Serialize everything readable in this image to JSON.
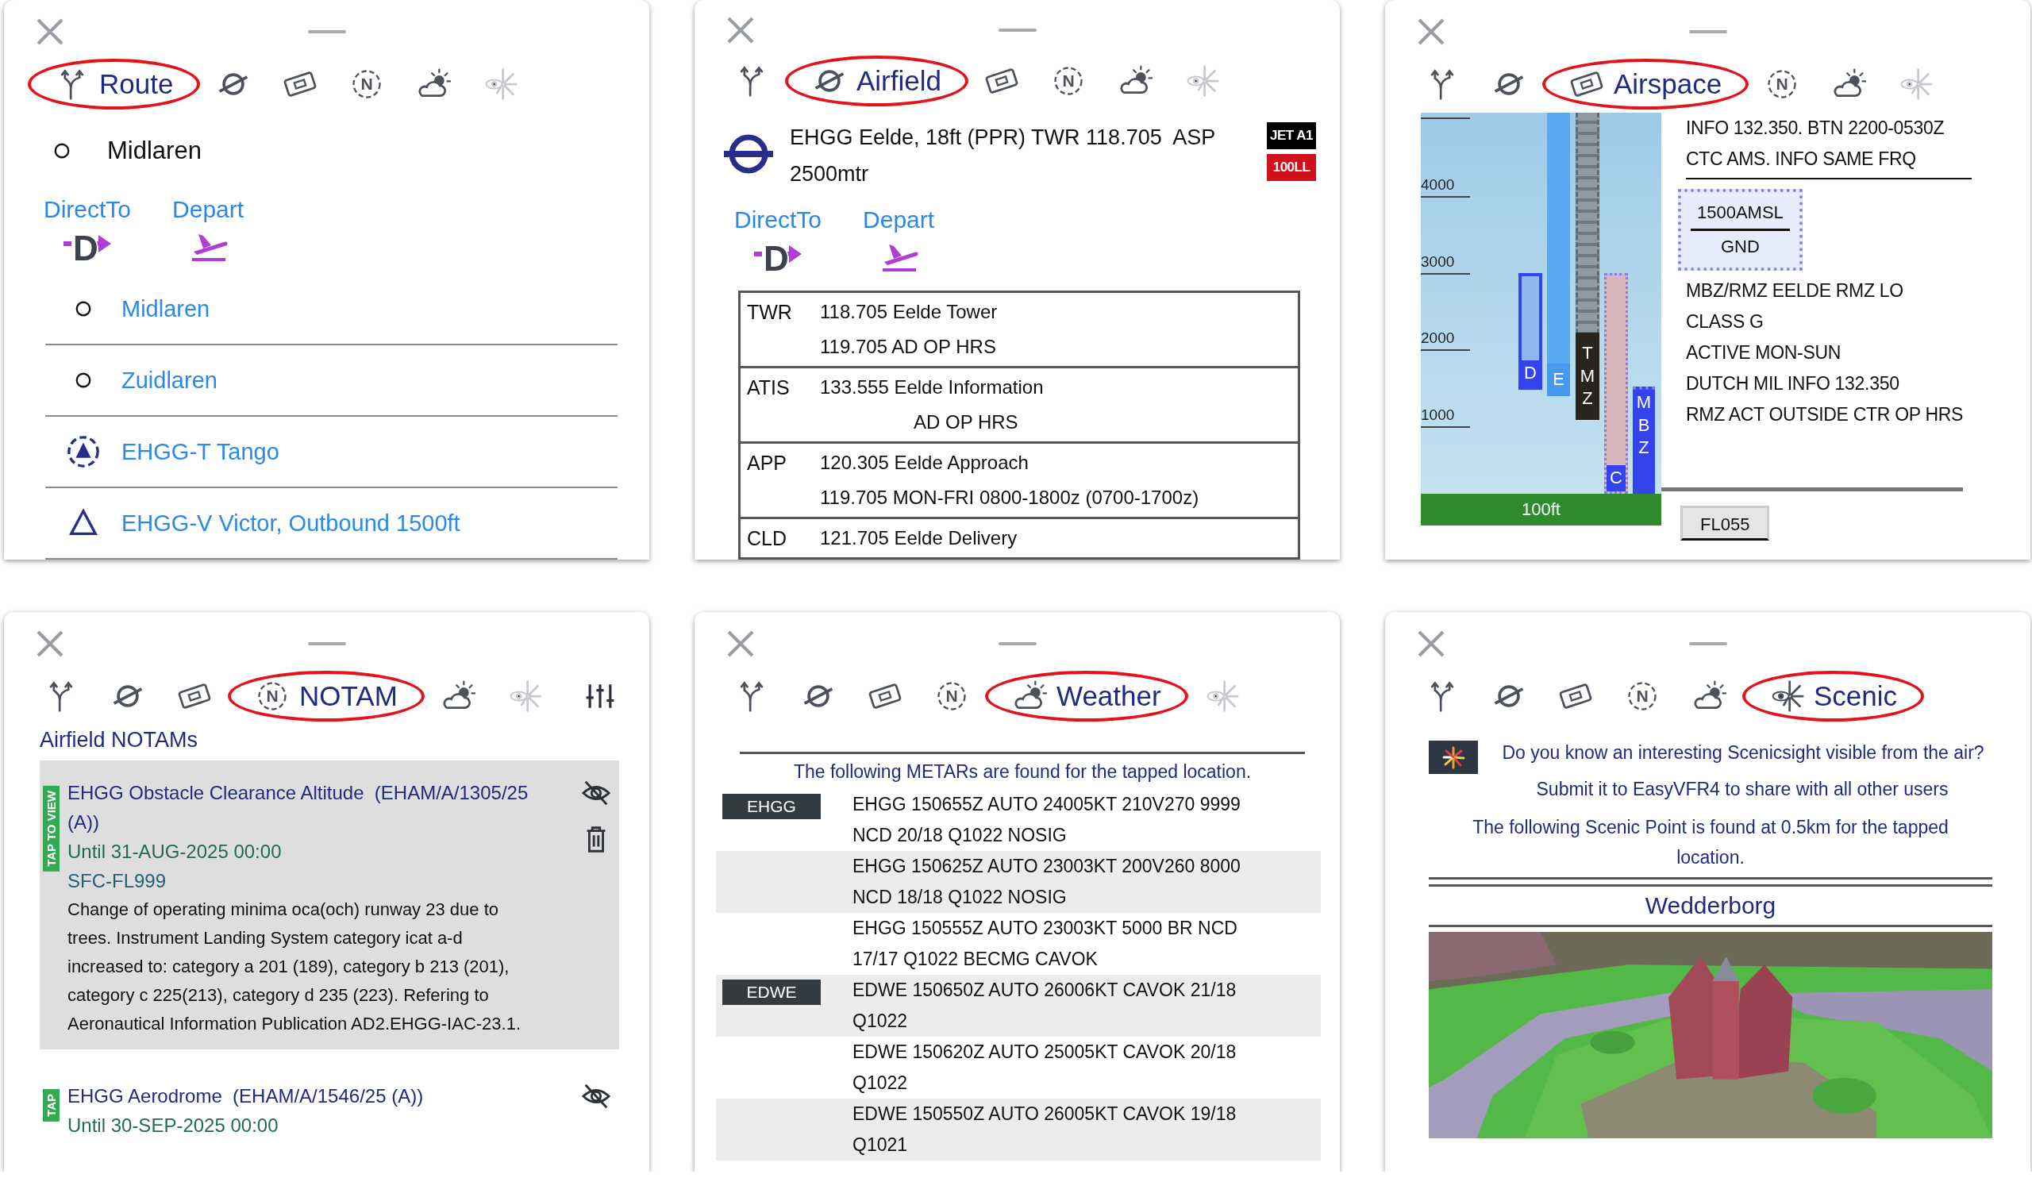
{
  "panels": [
    {
      "kind": "route",
      "tabs": [
        {
          "kind": "route",
          "label": "Route",
          "selected": true
        },
        {
          "kind": "airfield",
          "selected": false
        },
        {
          "kind": "airspace",
          "selected": false
        },
        {
          "kind": "notam",
          "glyph": "N",
          "selected": false
        },
        {
          "kind": "weather",
          "selected": false
        },
        {
          "kind": "scenic",
          "selected": false
        }
      ],
      "title": "Midlaren",
      "actions": [
        {
          "kind": "directto",
          "label": "DirectTo",
          "glyph": "D"
        },
        {
          "kind": "depart",
          "label": "Depart"
        }
      ],
      "points": [
        {
          "kind": "waypoint",
          "name": "Midlaren"
        },
        {
          "kind": "waypoint",
          "name": "Zuidlaren"
        },
        {
          "kind": "reporting",
          "name": "EHGG-T Tango"
        },
        {
          "kind": "triangle",
          "name": "EHGG-V Victor, Outbound 1500ft"
        }
      ]
    },
    {
      "kind": "airfield",
      "tabs": [
        {
          "kind": "route",
          "selected": false
        },
        {
          "kind": "airfield",
          "label": "Airfield",
          "selected": true
        },
        {
          "kind": "airspace",
          "selected": false
        },
        {
          "kind": "notam",
          "glyph": "N",
          "selected": false
        },
        {
          "kind": "weather",
          "selected": false
        },
        {
          "kind": "scenic",
          "selected": false
        }
      ],
      "title": "EHGG Eelde, 18ft (PPR) TWR 118.705  ASP 2500mtr",
      "fuels": [
        {
          "label": "JET A1",
          "color": "#000000"
        },
        {
          "label": "100LL",
          "color": "#d0101a"
        }
      ],
      "actions": [
        {
          "kind": "directto",
          "label": "DirectTo",
          "glyph": "D"
        },
        {
          "kind": "depart",
          "label": "Depart"
        }
      ],
      "frequencies": [
        {
          "service": "TWR",
          "lines": [
            {
              "text": "118.705 Eelde Tower",
              "indented": false
            },
            {
              "text": "119.705 AD OP HRS",
              "indented": false
            }
          ]
        },
        {
          "service": "ATIS",
          "lines": [
            {
              "text": "133.555 Eelde Information",
              "indented": false
            },
            {
              "text": "AD OP HRS",
              "indented": true
            }
          ]
        },
        {
          "service": "APP",
          "lines": [
            {
              "text": "120.305 Eelde Approach",
              "indented": false
            },
            {
              "text": "119.705 MON-FRI 0800-1800z (0700-1700z)",
              "indented": false
            }
          ]
        },
        {
          "service": "CLD",
          "lines": [
            {
              "text": "121.705 Eelde Delivery",
              "indented": false
            }
          ]
        }
      ]
    },
    {
      "kind": "airspace",
      "tabs": [
        {
          "kind": "route",
          "selected": false
        },
        {
          "kind": "airfield",
          "selected": false
        },
        {
          "kind": "airspace",
          "label": "Airspace",
          "selected": true
        },
        {
          "kind": "notam",
          "glyph": "N",
          "selected": false
        },
        {
          "kind": "weather",
          "selected": false
        },
        {
          "kind": "scenic",
          "selected": false
        }
      ],
      "profile": {
        "ticks": [
          "4000",
          "3000",
          "2000",
          "1000"
        ],
        "ground": "100ft",
        "zones": [
          {
            "kind": "class-d",
            "label": "D"
          },
          {
            "kind": "class-e",
            "label": "E"
          },
          {
            "kind": "tmz",
            "label": "TMZ"
          },
          {
            "kind": "class-c",
            "label": "C"
          },
          {
            "kind": "mbz",
            "label": "MBZ"
          }
        ]
      },
      "info": [
        "INFO 132.350. BTN 2200-0530Z",
        "CTC AMS. INFO SAME FRQ"
      ],
      "limits": {
        "upper": "1500AMSL",
        "lower": "GND"
      },
      "details": [
        "MBZ/RMZ EELDE RMZ LO",
        "CLASS G",
        "ACTIVE MON-SUN",
        "DUTCH MIL INFO 132.350",
        "RMZ ACT OUTSIDE CTR OP HRS"
      ],
      "next_limit": "FL055"
    },
    {
      "kind": "notam",
      "tabs": [
        {
          "kind": "route",
          "selected": false
        },
        {
          "kind": "airfield",
          "selected": false
        },
        {
          "kind": "airspace",
          "selected": false
        },
        {
          "kind": "notam",
          "glyph": "N",
          "label": "NOTAM",
          "selected": true
        },
        {
          "kind": "weather",
          "selected": false
        },
        {
          "kind": "scenic",
          "selected": false
        }
      ],
      "filter_button": true,
      "heading": "Airfield NOTAMs",
      "notams": [
        {
          "tag": "TAP TO VIEW",
          "title": "EHGG Obstacle Clearance Altitude  (EHAM/A/1305/25 (A))",
          "until": "Until 31-AUG-2025 00:00",
          "limits": "SFC-FL999",
          "body": "Change of operating minima oca(och) runway 23 due to trees. Instrument Landing System category icat a-d increased to: category a 201 (189), category b 213 (201), category c 225(213), category d 235 (223). Refering to Aeronautical Information Publication AD2.EHGG-IAC-23.1.",
          "expanded": true
        },
        {
          "tag": "TAP",
          "title": "EHGG Aerodrome  (EHAM/A/1546/25 (A))",
          "until": "Until 30-SEP-2025 00:00",
          "expanded": false
        }
      ]
    },
    {
      "kind": "weather",
      "tabs": [
        {
          "kind": "route",
          "selected": false
        },
        {
          "kind": "airfield",
          "selected": false
        },
        {
          "kind": "airspace",
          "selected": false
        },
        {
          "kind": "notam",
          "glyph": "N",
          "selected": false
        },
        {
          "kind": "weather",
          "label": "Weather",
          "selected": true
        },
        {
          "kind": "scenic",
          "selected": false
        }
      ],
      "intro": "The following METARs are found for the tapped location.",
      "stations": [
        {
          "code": "EHGG",
          "metars": [
            "EHGG 150655Z AUTO 24005KT 210V270 9999 NCD 20/18 Q1022 NOSIG",
            "EHGG 150625Z AUTO 23003KT 200V260 8000 NCD 18/18 Q1022 NOSIG",
            "EHGG 150555Z AUTO 23003KT 5000 BR NCD 17/17 Q1022 BECMG CAVOK"
          ]
        },
        {
          "code": "EDWE",
          "metars": [
            "EDWE 150650Z AUTO 26006KT CAVOK 21/18 Q1022",
            "EDWE 150620Z AUTO 25005KT CAVOK 20/18 Q1022",
            "EDWE 150550Z AUTO 26005KT CAVOK 19/18 Q1021"
          ]
        }
      ]
    },
    {
      "kind": "scenic",
      "tabs": [
        {
          "kind": "route",
          "selected": false
        },
        {
          "kind": "airfield",
          "selected": false
        },
        {
          "kind": "airspace",
          "selected": false
        },
        {
          "kind": "notam",
          "glyph": "N",
          "selected": false
        },
        {
          "kind": "weather",
          "selected": false
        },
        {
          "kind": "scenic",
          "label": "Scenic",
          "selected": true
        }
      ],
      "prompt": "Do you know an interesting Scenicsight visible from the air?",
      "submit": "Submit it to EasyVFR4 to share with all other users",
      "found": "The following Scenic Point is found at 0.5km for the tapped location.",
      "name": "Wedderborg"
    }
  ]
}
